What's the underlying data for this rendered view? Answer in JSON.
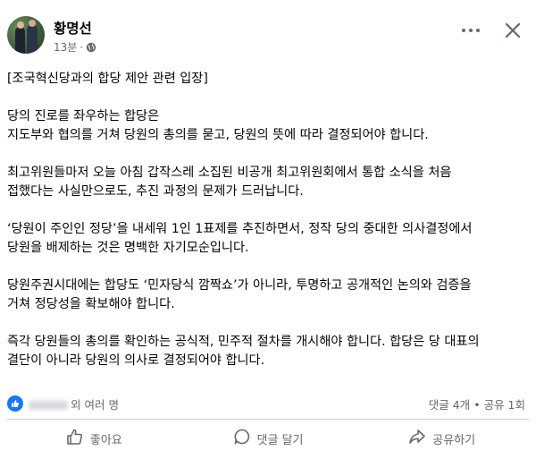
{
  "post": {
    "author": "황명선",
    "time": "13분",
    "audience_icon": "globe-icon",
    "paragraphs": [
      [
        "[조국혁신당과의 합당 제안 관련 입장]"
      ],
      [
        "당의 진로를 좌우하는 합당은",
        "지도부와 협의를 거쳐 당원의 총의를 묻고, 당원의 뜻에 따라 결정되어야 합니다."
      ],
      [
        "최고위원들마저 오늘 아침 갑작스레 소집된 비공개 최고위원회에서 통합 소식을 처음",
        "접했다는 사실만으로도, 추진 과정의 문제가 드러납니다."
      ],
      [
        "‘당원이 주인인 정당’을 내세워 1인 1표제를 추진하면서, 정작 당의 중대한 의사결정에서",
        "당원을 배제하는 것은 명백한 자기모순입니다."
      ],
      [
        "당원주권시대에는 합당도 ‘민자당식 깜짝쇼’가 아니라, 투명하고 공개적인 논의와 검증을",
        "거쳐 정당성을 확보해야 합니다."
      ],
      [
        "즉각 당원들의 총의를 확인하는 공식적, 민주적 절차를 개시해야 합니다. 합당은 당 대표의",
        "결단이 아니라 당원의 의사로 결정되어야 합니다."
      ]
    ]
  },
  "reactions": {
    "icon": "like-icon",
    "names_visible": "외 여러 명",
    "comments": "댓글 4개",
    "separator": "•",
    "shares": "공유 1회"
  },
  "actions": {
    "like": "좋아요",
    "comment": "댓글 달기",
    "share": "공유하기"
  },
  "colors": {
    "text": "#050505",
    "secondary": "#65676b",
    "accent": "#1877f2",
    "divider": "#ced0d4"
  }
}
